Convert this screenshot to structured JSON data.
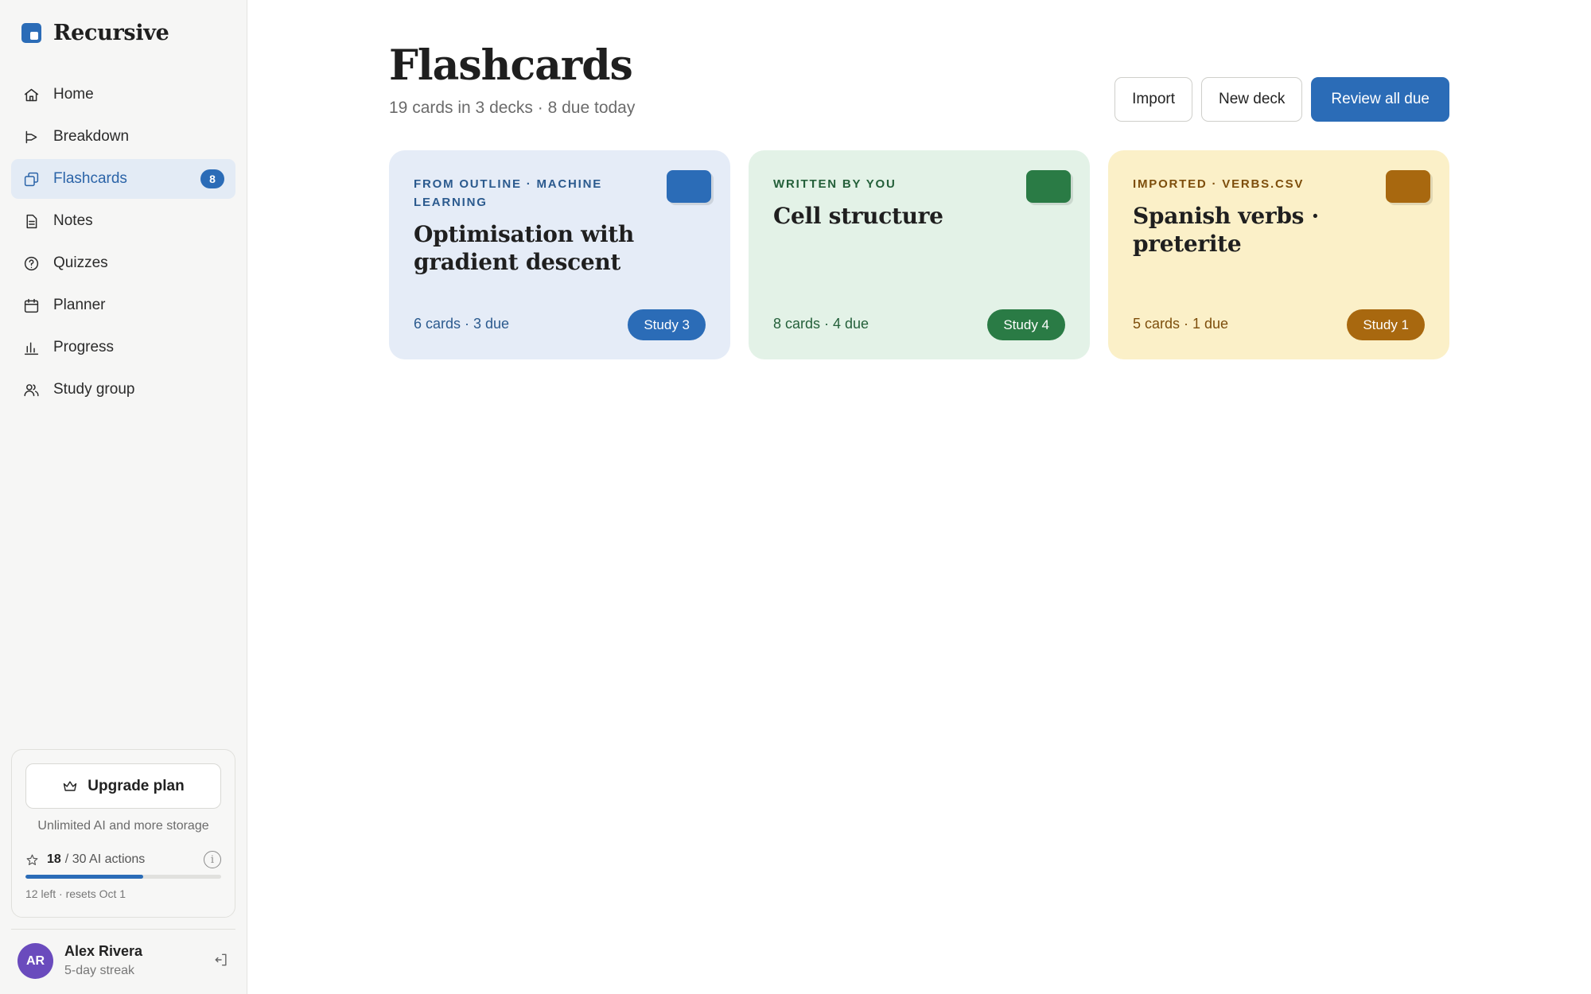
{
  "app": {
    "name": "Recursive"
  },
  "colors": {
    "accent": "#2b6cb7",
    "blue_deck_bg": "#e5ecf7",
    "green_deck_bg": "#e3f2e7",
    "yellow_deck_bg": "#fbf0c8",
    "green_accent": "#2a7b45",
    "amber_accent": "#a8680f",
    "avatar": "#6a4bbd"
  },
  "sidebar": {
    "items": [
      {
        "label": "Home",
        "icon": "home-icon"
      },
      {
        "label": "Breakdown",
        "icon": "breakdown-icon"
      },
      {
        "label": "Flashcards",
        "icon": "flashcards-icon",
        "badge": "8",
        "active": true
      },
      {
        "label": "Notes",
        "icon": "notes-icon"
      },
      {
        "label": "Quizzes",
        "icon": "quiz-icon"
      },
      {
        "label": "Planner",
        "icon": "calendar-icon"
      },
      {
        "label": "Progress",
        "icon": "chart-icon"
      },
      {
        "label": "Study group",
        "icon": "users-icon"
      }
    ],
    "upgrade": {
      "button_label": "Upgrade plan",
      "subtitle": "Unlimited AI and more storage",
      "usage_used": "18",
      "usage_rest": "/ 30 AI actions",
      "usage_fraction": 0.6,
      "info_glyph": "i",
      "note": "12 left · resets Oct 1"
    },
    "user": {
      "initials": "AR",
      "name": "Alex Rivera",
      "streak": "5-day streak"
    }
  },
  "main": {
    "title": "Flashcards",
    "subtitle": "19 cards in 3 decks · 8 due today",
    "actions": {
      "import": "Import",
      "new_deck": "New deck",
      "review_all": "Review all due"
    },
    "decks": [
      {
        "eyebrow": "FROM OUTLINE · MACHINE LEARNING",
        "title": "Optimisation with gradient descent",
        "meta": "6 cards · 3 due",
        "study": "Study 3"
      },
      {
        "eyebrow": "WRITTEN BY YOU",
        "title": "Cell structure",
        "meta": "8 cards · 4 due",
        "study": "Study 4"
      },
      {
        "eyebrow": "IMPORTED · VERBS.CSV",
        "title": "Spanish verbs · preterite",
        "meta": "5 cards · 1 due",
        "study": "Study 1"
      }
    ]
  }
}
